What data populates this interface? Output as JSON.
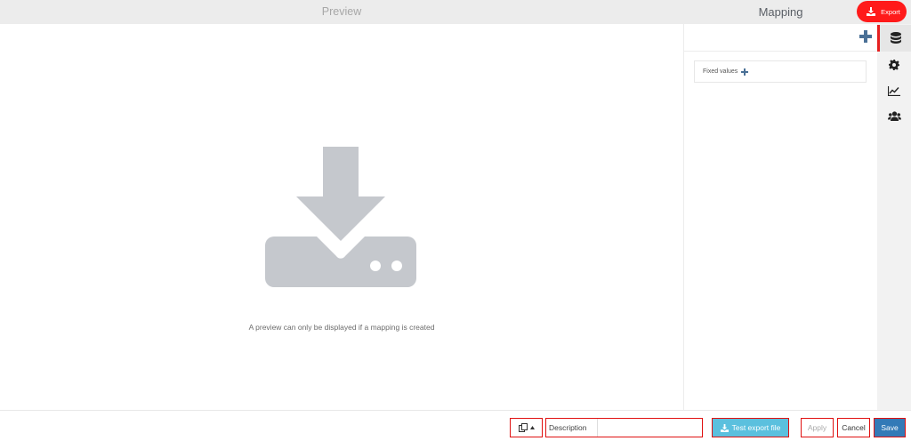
{
  "header": {
    "preview_title": "Preview",
    "mapping_title": "Mapping",
    "export_label": "Export"
  },
  "preview": {
    "icon": "download-tray-icon",
    "message": "A preview can only be displayed if a mapping is created"
  },
  "mapping": {
    "add_icon": "plus-icon",
    "fixed_values_label": "Fixed values"
  },
  "sidebar": {
    "items": [
      {
        "icon": "database-icon",
        "active": true
      },
      {
        "icon": "gear-icon",
        "active": false
      },
      {
        "icon": "line-chart-icon",
        "active": false
      },
      {
        "icon": "users-icon",
        "active": false
      }
    ]
  },
  "footer": {
    "copy_icon": "copy-icon",
    "description_label": "Description",
    "description_value": "",
    "test_export_label": "Test export file",
    "apply_label": "Apply",
    "cancel_label": "Cancel",
    "save_label": "Save"
  },
  "colors": {
    "export_red": "#ff1a1a",
    "icon_gray": "#c5c8cd",
    "plus_blue": "#4a7096",
    "test_button": "#5bc0de",
    "save_button": "#337ab7",
    "highlight_border": "#e01010"
  }
}
